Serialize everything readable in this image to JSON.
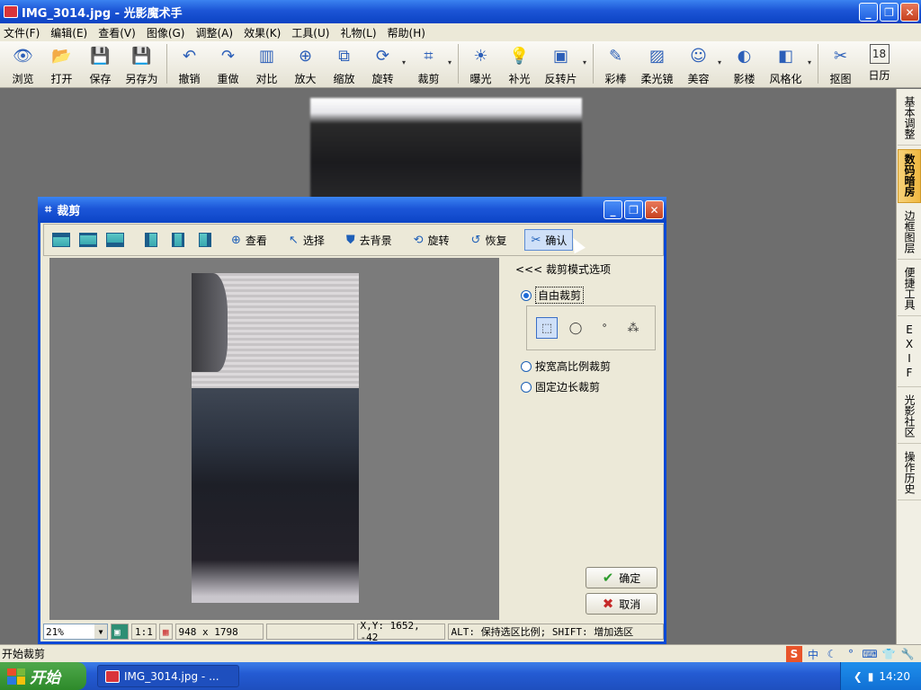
{
  "window": {
    "title": "IMG_3014.jpg - 光影魔术手",
    "min": "_",
    "max": "❐",
    "close": "✕"
  },
  "menu": [
    "文件(F)",
    "编辑(E)",
    "查看(V)",
    "图像(G)",
    "调整(A)",
    "效果(K)",
    "工具(U)",
    "礼物(L)",
    "帮助(H)"
  ],
  "toolbar": [
    {
      "label": "浏览",
      "icon": "👁"
    },
    {
      "label": "打开",
      "icon": "📂"
    },
    {
      "label": "保存",
      "icon": "💾"
    },
    {
      "label": "另存为",
      "icon": "💾"
    },
    {
      "label": "撤销",
      "icon": "↶"
    },
    {
      "label": "重做",
      "icon": "↷"
    },
    {
      "label": "对比",
      "icon": "▥"
    },
    {
      "label": "放大",
      "icon": "⊕"
    },
    {
      "label": "缩放",
      "icon": "⧉"
    },
    {
      "label": "旋转",
      "icon": "⟳"
    },
    {
      "label": "裁剪",
      "icon": "⌗"
    },
    {
      "label": "曝光",
      "icon": "☀"
    },
    {
      "label": "补光",
      "icon": "💡"
    },
    {
      "label": "反转片",
      "icon": "▣"
    },
    {
      "label": "彩棒",
      "icon": "✎"
    },
    {
      "label": "柔光镜",
      "icon": "▨"
    },
    {
      "label": "美容",
      "icon": "☺"
    },
    {
      "label": "影楼",
      "icon": "◐"
    },
    {
      "label": "风格化",
      "icon": "◧"
    },
    {
      "label": "抠图",
      "icon": "✂"
    },
    {
      "label": "日历",
      "icon": "18"
    }
  ],
  "right_tabs": [
    "基本调整",
    "数码暗房",
    "边框图层",
    "便捷工具",
    "EXIF",
    "光影社区",
    "操作历史"
  ],
  "statusbar": {
    "text": "开始裁剪",
    "ime": [
      "S",
      "中",
      "☾",
      "°",
      "⌨",
      "👕",
      "🔧"
    ]
  },
  "taskbar": {
    "start": "开始",
    "item": "IMG_3014.jpg - ...",
    "time": "14:20"
  },
  "dialog": {
    "title": "裁剪",
    "buttons": [
      {
        "label": "查看",
        "icon": "⊕"
      },
      {
        "label": "选择",
        "icon": "↖"
      },
      {
        "label": "去背景",
        "icon": "⛊"
      },
      {
        "label": "旋转",
        "icon": "⟲"
      },
      {
        "label": "恢复",
        "icon": "↺"
      },
      {
        "label": "确认",
        "icon": "✂"
      }
    ],
    "options_title": "<<< 裁剪模式选项",
    "modes": [
      "自由裁剪",
      "按宽高比例裁剪",
      "固定边长裁剪"
    ],
    "ok": "确定",
    "cancel": "取消",
    "status": {
      "zoom": "21%",
      "one_to_one": "1:1",
      "size": "948 x 1798",
      "coords": "X,Y: 1652, -42",
      "hint": "ALT: 保持选区比例;  SHIFT: 增加选区"
    }
  },
  "colors": {
    "xp_blue": "#0c43c3",
    "panel_bg": "#ece9d8",
    "canvas": "#6e6e6e",
    "active_tab": "#f0b840"
  }
}
